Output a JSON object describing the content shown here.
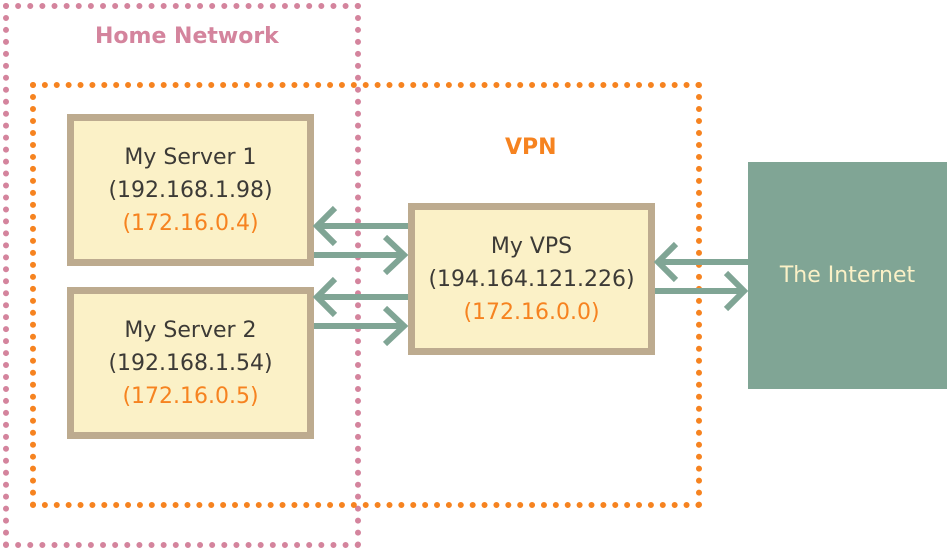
{
  "zones": {
    "home": {
      "label": "Home Network",
      "color": "#d4849d"
    },
    "vpn": {
      "label": "VPN",
      "color": "#f68320"
    }
  },
  "nodes": {
    "server1": {
      "name": "My Server 1",
      "lan_ip": "(192.168.1.98)",
      "vpn_ip": "(172.16.0.4)"
    },
    "server2": {
      "name": "My Server 2",
      "lan_ip": "(192.168.1.54)",
      "vpn_ip": "(172.16.0.5)"
    },
    "vps": {
      "name": "My VPS",
      "public_ip": "(194.164.121.226)",
      "vpn_ip": "(172.16.0.0)"
    },
    "internet": {
      "name": "The Internet"
    }
  },
  "connections": [
    {
      "from": "vps",
      "to": "server1",
      "direction": "bidirectional"
    },
    {
      "from": "vps",
      "to": "server2",
      "direction": "bidirectional"
    },
    {
      "from": "vps",
      "to": "internet",
      "direction": "bidirectional"
    }
  ],
  "colors": {
    "node_fill": "#fbf1c7",
    "node_border": "#bdab8f",
    "arrow": "#80a595",
    "internet_fill": "#80a595",
    "text": "#3c3a36"
  }
}
